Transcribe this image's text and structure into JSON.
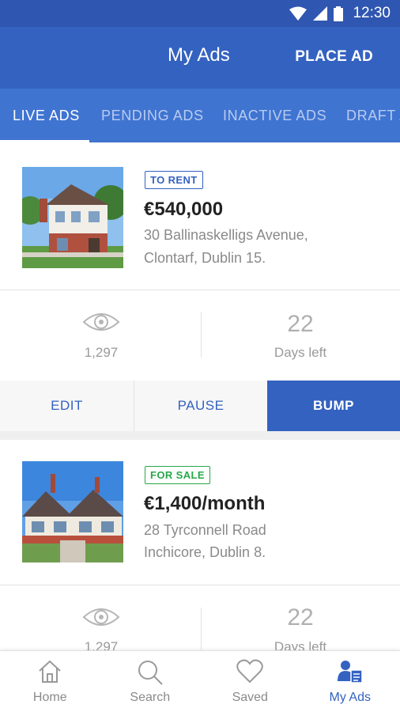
{
  "status_bar": {
    "time": "12:30"
  },
  "app_bar": {
    "title": "My Ads",
    "action": "PLACE AD"
  },
  "tabs": [
    {
      "label": "LIVE ADS",
      "active": true
    },
    {
      "label": "PENDING ADS",
      "active": false
    },
    {
      "label": "INACTIVE ADS",
      "active": false
    },
    {
      "label": "DRAFT ADS",
      "active": false
    }
  ],
  "ads": [
    {
      "badge": "TO RENT",
      "price": "€540,000",
      "address_line1": "30 Ballinaskelligs Avenue,",
      "address_line2": "Clontarf, Dublin 15.",
      "views": "1,297",
      "days_left": "22",
      "days_left_label": "Days left",
      "actions": {
        "edit": "EDIT",
        "pause": "PAUSE",
        "bump": "BUMP"
      }
    },
    {
      "badge": "FOR SALE",
      "price": "€1,400/month",
      "address_line1": "28 Tyrconnell Road",
      "address_line2": "Inchicore, Dublin 8.",
      "views": "1,297",
      "days_left": "22",
      "days_left_label": "Days left"
    }
  ],
  "bottom_nav": [
    {
      "label": "Home",
      "icon": "home-icon"
    },
    {
      "label": "Search",
      "icon": "search-icon"
    },
    {
      "label": "Saved",
      "icon": "heart-icon"
    },
    {
      "label": "My Ads",
      "icon": "my-ads-icon",
      "active": true
    }
  ],
  "colors": {
    "primary": "#3462c1",
    "status_bar": "#2f56b0",
    "tab_bar": "#3f74d1",
    "rent_badge": "#3462c1",
    "sale_badge": "#27a84a"
  }
}
